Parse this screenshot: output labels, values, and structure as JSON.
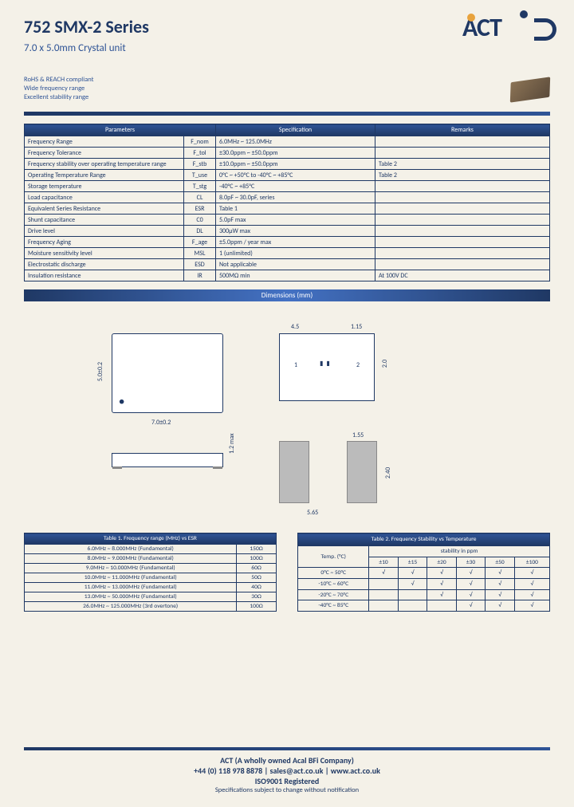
{
  "header": {
    "title": "752 SMX-2 Series",
    "subtitle": "7.0 x 5.0mm Crystal unit",
    "logo_text": "ACT"
  },
  "features": {
    "f1": "RoHS & REACH compliant",
    "f2": "Wide frequency range",
    "f3": "Excellent stability range"
  },
  "params": {
    "th1": "Parameters",
    "th2": "Specification",
    "th3": "Remarks",
    "rows": [
      {
        "p": "Frequency Range",
        "s": "F_nom",
        "v": "6.0MHz ~ 125.0MHz",
        "r": ""
      },
      {
        "p": "Frequency Tolerance",
        "s": "F_tol",
        "v": "±30.0ppm ~ ±50.0ppm",
        "r": ""
      },
      {
        "p": "Frequency stability over operating temperature range",
        "s": "F_stb",
        "v": "±10.0ppm ~ ±50.0ppm",
        "r": "Table 2"
      },
      {
        "p": "Operating Temperature Range",
        "s": "T_use",
        "v": "0°C ~ +50°C to -40°C ~ +85°C",
        "r": "Table 2"
      },
      {
        "p": "Storage temperature",
        "s": "T_stg",
        "v": "-40°C ~ +85°C",
        "r": ""
      },
      {
        "p": "Load capacitance",
        "s": "CL",
        "v": "8.0pF ~ 30.0pF, series",
        "r": ""
      },
      {
        "p": "Equivalent Series Resistance",
        "s": "ESR",
        "v": "Table 1",
        "r": ""
      },
      {
        "p": "Shunt capacitance",
        "s": "C0",
        "v": "5.0pF max",
        "r": ""
      },
      {
        "p": "Drive level",
        "s": "DL",
        "v": "300µW max",
        "r": ""
      },
      {
        "p": "Frequency Aging",
        "s": "F_age",
        "v": "±5.0ppm / year max",
        "r": ""
      },
      {
        "p": "Moisture sensitivity level",
        "s": "MSL",
        "v": "1 (unlimited)",
        "r": ""
      },
      {
        "p": "Electrostatic discharge",
        "s": "ESD",
        "v": "Not applicable",
        "r": ""
      },
      {
        "p": "Insulation resistance",
        "s": "IR",
        "v": "500MΩ min",
        "r": "At 100V DC"
      }
    ]
  },
  "dims": {
    "title": "Dimensions (mm)",
    "w": "7.0±0.2",
    "h": "5.0±0.2",
    "top_a": "4.5",
    "top_b": "1.15",
    "pin1": "1",
    "pin2": "2",
    "top_h": "2.0",
    "side_t": "1.2 max",
    "bot_w": "5.65",
    "pad_w": "1.55",
    "pad_h": "2.40"
  },
  "table1": {
    "title": "Table 1. Frequency range (MHz) vs ESR",
    "rows": [
      {
        "f": "6.0MHz ~ 8.000MHz (Fundamental)",
        "e": "150Ω"
      },
      {
        "f": "8.0MHz ~ 9.000MHz (Fundamental)",
        "e": "100Ω"
      },
      {
        "f": "9.0MHz ~ 10.000MHz (Fundamental)",
        "e": "60Ω"
      },
      {
        "f": "10.0MHz ~ 11.000MHz (Fundamental)",
        "e": "50Ω"
      },
      {
        "f": "11.0MHz ~ 13.000MHz (Fundamental)",
        "e": "40Ω"
      },
      {
        "f": "13.0MHz ~ 50.000MHz (Fundamental)",
        "e": "30Ω"
      },
      {
        "f": "26.0MHz ~ 125.000MHz (3rd overtone)",
        "e": "100Ω"
      }
    ]
  },
  "table2": {
    "title": "Table 2. Frequency Stability vs Temperature",
    "col_temp": "Temp. (°C)",
    "col_stab": "stability in ppm",
    "heads": [
      "±10",
      "±15",
      "±20",
      "±30",
      "±50",
      "±100"
    ],
    "rows": [
      {
        "t": "0°C ~ 50°C",
        "c": [
          "√",
          "√",
          "√",
          "√",
          "√",
          "√"
        ]
      },
      {
        "t": "-10°C ~ 60°C",
        "c": [
          "",
          "√",
          "√",
          "√",
          "√",
          "√"
        ]
      },
      {
        "t": "-20°C ~ 70°C",
        "c": [
          "",
          "",
          "√",
          "√",
          "√",
          "√"
        ]
      },
      {
        "t": "-40°C ~ 85°C",
        "c": [
          "",
          "",
          "",
          "√",
          "√",
          "√"
        ]
      }
    ]
  },
  "footer": {
    "l1": "ACT (A wholly owned Acal BFi Company)",
    "l2": "+44 (0) 118 978 8878 | sales@act.co.uk | www.act.co.uk",
    "l3": "ISO9001 Registered",
    "l4": "Specifications subject to change without notification"
  }
}
